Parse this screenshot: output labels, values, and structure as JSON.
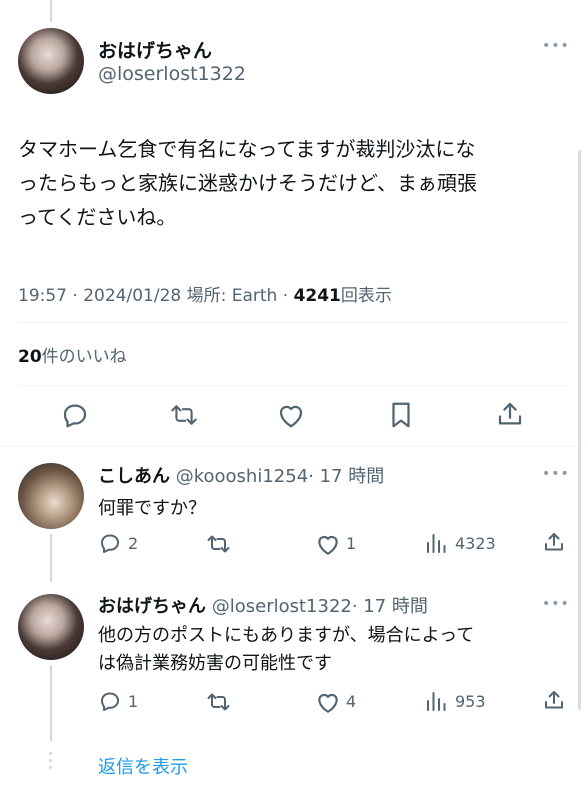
{
  "main_post": {
    "display_name": "おはげちゃん",
    "handle": "@loserlost1322",
    "body_lines": [
      "タマホーム乞食で有名になってますが裁判沙汰にな",
      "ったらもっと家族に迷惑かけそうだけど、まぁ頑張",
      "ってくださいね。"
    ],
    "time": "19:57",
    "sep": "·",
    "date": "2024/01/28",
    "location": "場所: Earth",
    "views_count": "4241",
    "views_label": "回表示",
    "likes_count": "20",
    "likes_label": "件のいいね",
    "more_icon": "more-icon"
  },
  "replies": [
    {
      "display_name": "こしあん",
      "handle": "@koooshi1254",
      "time_ago": "· 17 時間",
      "text_lines": [
        "何罪ですか？"
      ],
      "reply_count": "2",
      "retweet_count": "",
      "like_count": "1",
      "view_count": "4323"
    },
    {
      "display_name": "おはげちゃん",
      "handle": "@loserlost1322",
      "time_ago": "· 17 時間",
      "text_lines": [
        "他の方のポストにもありますが、場合によって",
        "は偽計業務妨害の可能性です"
      ],
      "reply_count": "1",
      "retweet_count": "",
      "like_count": "4",
      "view_count": "953"
    }
  ],
  "show_replies": "返信を表示",
  "colors": {
    "link": "#1d9bf0",
    "muted": "#536471",
    "line": "#cfd9de"
  }
}
